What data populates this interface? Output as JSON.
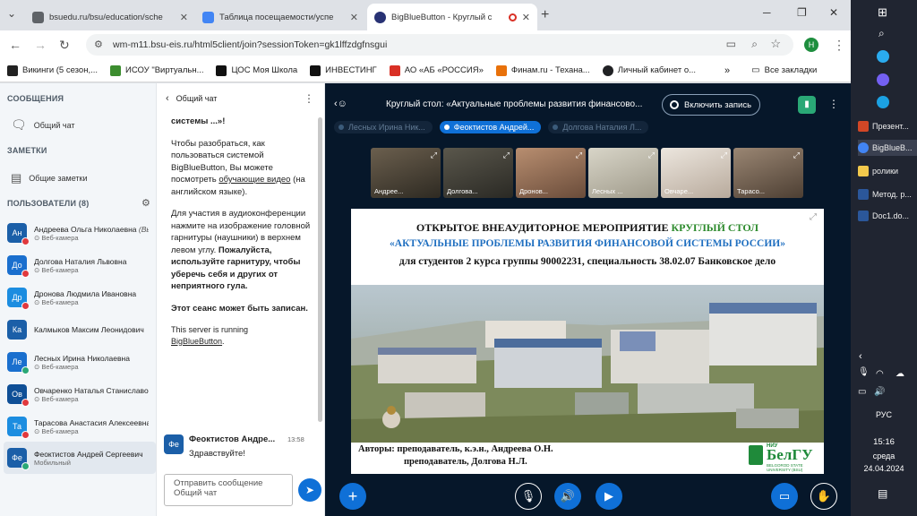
{
  "browser": {
    "tabs": [
      {
        "title": "bsuedu.ru/bsu/education/sche",
        "color": "#5f6368"
      },
      {
        "title": "Таблица посещаемости/успе",
        "color": "#4285f4"
      },
      {
        "title": "BigBlueButton - Круглый с",
        "color": "#283274"
      }
    ],
    "url": "wm-m11.bsu-eis.ru/html5client/join?sessionToken=gk1lffzdgfnsgui",
    "profile_initial": "H",
    "bookmarks": [
      {
        "label": "Викинги (5 сезон,...",
        "color": "#222222"
      },
      {
        "label": "ИСОУ \"Виртуальн...",
        "color": "#3c8d2f"
      },
      {
        "label": "ЦОС Моя Школа",
        "color": "#111111"
      },
      {
        "label": "ИНВЕСТИНГ",
        "color": "#111111"
      },
      {
        "label": "АО «АБ «РОССИЯ»",
        "color": "#d93025"
      },
      {
        "label": "Финам.ru - Техана...",
        "color": "#e8710a"
      },
      {
        "label": "Личный кабинет о...",
        "color": "#202124"
      }
    ],
    "all_bookmarks": "Все закладки",
    "more_bookmarks": "»"
  },
  "sidebar": {
    "messages_title": "СООБЩЕНИЯ",
    "public_chat": "Общий чат",
    "notes_title": "ЗАМЕТКИ",
    "shared_notes": "Общие заметки",
    "users_title": "ПОЛЬЗОВАТЕЛИ (8)",
    "users": [
      {
        "initials": "Ан",
        "name": "Андреева Ольга Николаевна",
        "you": "(Вы)",
        "sub": "Веб-камера",
        "color": "#1b5fa8",
        "status": "#e0393e"
      },
      {
        "initials": "До",
        "name": "Долгова Наталия Львовна",
        "sub": "Веб-камера",
        "color": "#1a6fce",
        "status": "#e0393e"
      },
      {
        "initials": "Др",
        "name": "Дронова Людмила Ивановна",
        "sub": "Веб-камера",
        "color": "#1c8de0",
        "status": "#e0393e"
      },
      {
        "initials": "Ка",
        "name": "Калмыков Максим Леонидович",
        "sub": "",
        "color": "#1b5fa8",
        "status": ""
      },
      {
        "initials": "Ле",
        "name": "Лесных Ирина Николаевна",
        "sub": "Веб-камера",
        "color": "#1a6fce",
        "status": "#2aa876"
      },
      {
        "initials": "Ов",
        "name": "Овчаренко Наталья Станиславовна",
        "sub": "Веб-камера",
        "color": "#0f4f96",
        "status": "#e0393e"
      },
      {
        "initials": "Та",
        "name": "Тарасова Анастасия Алексеевна",
        "sub": "Веб-камера",
        "color": "#1c8de0",
        "status": "#e0393e"
      },
      {
        "initials": "Фе",
        "name": "Феоктистов Андрей Сергеевич",
        "sub": "Мобильный",
        "color": "#1b5fa8",
        "status": "#2aa876"
      }
    ]
  },
  "chat": {
    "title": "Общий чат",
    "lines": [
      "системы ...»!",
      "Чтобы разобраться, как пользоваться системой BigBlueButton, Вы можете посмотреть",
      "обучающие видео",
      "(на английском языке).",
      "Для участия в аудиоконференции нажмите на изображение головной гарнитуры (наушники) в верхнем левом углу.",
      "Пожалуйста, используйте гарнитуру, чтобы уберечь себя и других от неприятного гула.",
      "Этот сеанс может быть записан.",
      "This server is running",
      "BigBlueButton"
    ],
    "last_sender_initials": "Фе",
    "last_sender": "Феоктистов Андре...",
    "last_time": "13:58",
    "last_text": "Здравствуйте!",
    "input_placeholder": "Отправить сообщение Общий чат"
  },
  "meeting": {
    "title": "Круглый стол: «Актуальные проблемы развития финансово...",
    "record_label": "Включить запись",
    "talkers": [
      {
        "name": "Лесных Ирина Ник...",
        "active": false
      },
      {
        "name": "Феоктистов Андрей...",
        "active": true
      },
      {
        "name": "Долгова Наталия Л...",
        "active": false
      }
    ],
    "videos": [
      {
        "name": "Андрее...",
        "bg": "#4d4538"
      },
      {
        "name": "Долгова...",
        "bg": "#3b3a33"
      },
      {
        "name": "Дронов...",
        "bg": "#8a6c5c"
      },
      {
        "name": "Лесных ...",
        "bg": "#b8b4a6"
      },
      {
        "name": "Овчаре...",
        "bg": "#cfc7bd"
      },
      {
        "name": "Тарасо...",
        "bg": "#6b5a4b"
      }
    ]
  },
  "slide": {
    "line1_a": "ОТКРЫТОЕ ВНЕАУДИТОРНОЕ МЕРОПРИЯТИЕ",
    "line1_b": "КРУГЛЫЙ СТОЛ",
    "line2": "«АКТУАЛЬНЫЕ ПРОБЛЕМЫ РАЗВИТИЯ ФИНАНСОВОЙ СИСТЕМЫ РОССИИ»",
    "line3": "для студентов 2 курса группы 90002231, специальность 38.02.07  Банковское дело",
    "authors_1": "Авторы: преподаватель, к.э.н., Андреева О.Н.",
    "authors_2": "преподаватель, Долгова Н.Л.",
    "logo_small": "НИУ",
    "logo_big": "БелГУ",
    "logo_sub": "BELGOROD STATE UNIVERSITY (BSU)"
  },
  "taskbar": {
    "items": [
      {
        "label": "Презент...",
        "color": "#d24726"
      },
      {
        "label": "BigBlueB...",
        "color": "#4285f4"
      },
      {
        "label": "ролики",
        "color": "#f2c94c"
      },
      {
        "label": "Метод. р...",
        "color": "#2b579a"
      },
      {
        "label": "Doc1.do...",
        "color": "#2b579a"
      }
    ],
    "lang": "РУС",
    "day": "среда",
    "time": "15:16",
    "date": "24.04.2024"
  }
}
